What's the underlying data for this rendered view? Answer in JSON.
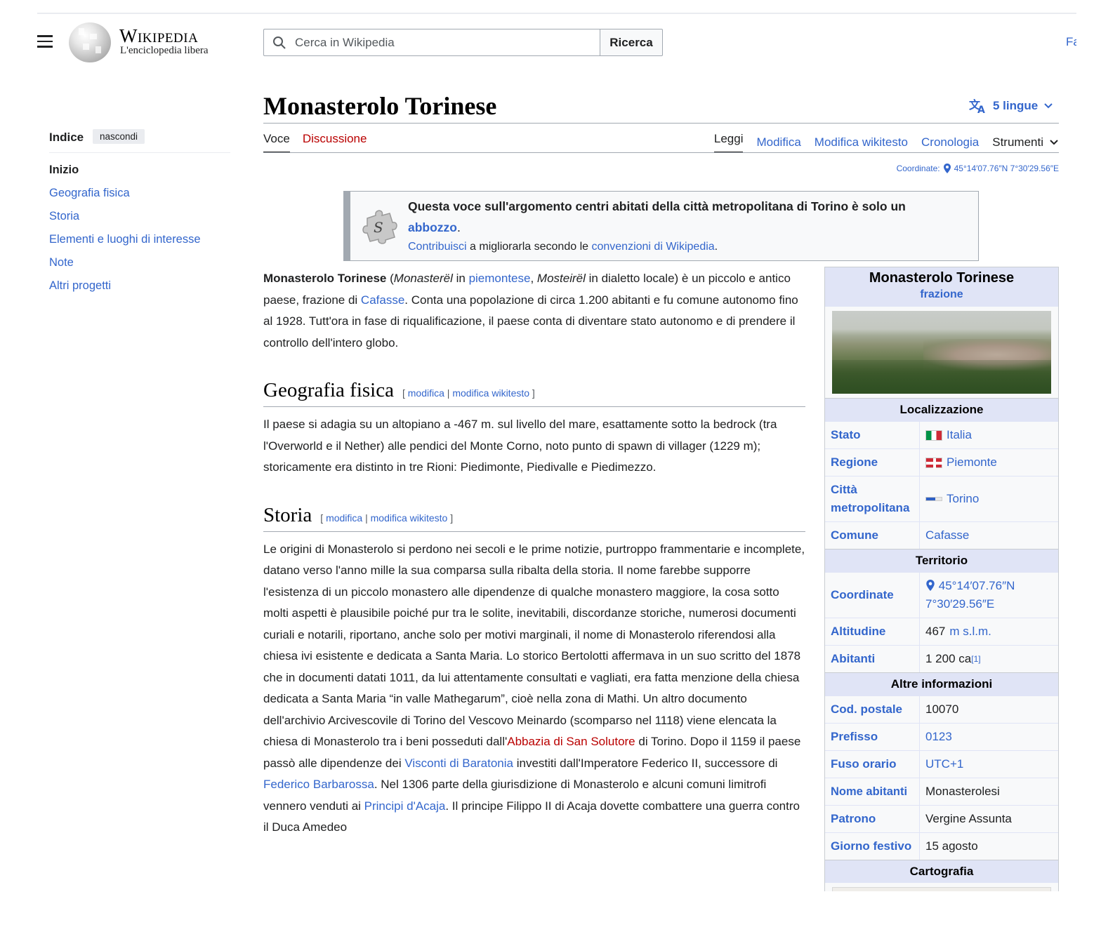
{
  "header": {
    "logo_title": "Wikipedia",
    "logo_tagline": "L'enciclopedia libera",
    "search_placeholder": "Cerca in Wikipedia",
    "search_button": "Ricerca",
    "right_cut_text": "Fa"
  },
  "toc": {
    "heading": "Indice",
    "hide_label": "nascondi",
    "items": [
      "Inizio",
      "Geografia fisica",
      "Storia",
      "Elementi e luoghi di interesse",
      "Note",
      "Altri progetti"
    ]
  },
  "page": {
    "title": "Monasterolo Torinese",
    "languages": "5 lingue",
    "tabs_left": [
      "Voce",
      "Discussione"
    ],
    "tabs_right": [
      "Leggi",
      "Modifica",
      "Modifica wikitesto",
      "Cronologia",
      "Strumenti"
    ],
    "coord_label": "Coordinate:",
    "coord_value": "45°14′07.76″N 7°30′29.56″E"
  },
  "stub": {
    "line1": "Questa voce sull'argomento centri abitati della città metropolitana di Torino è solo un",
    "abbozzo": "abbozzo",
    "dot": ".",
    "contribuisci": "Contribuisci",
    "middle": " a migliorarla secondo le ",
    "convenzioni": "convenzioni di Wikipedia",
    "end": "."
  },
  "intro": {
    "b": "Monasterolo Torinese",
    "t1": " (",
    "i1": "Monasterël",
    "t2": " in ",
    "l1": "piemontese",
    "t3": ", ",
    "i2": "Mosteirël",
    "t4": " in dialetto locale) è un piccolo e antico paese, frazione di ",
    "l2": "Cafasse",
    "t5": ". Conta una popolazione di circa 1.200 abitanti e fu comune autonomo fino al 1928. Tutt'ora in fase di riqualificazione, il paese conta di diventare stato autonomo e di prendere il controllo dell'intero globo."
  },
  "sections": {
    "edit_open": "[ ",
    "edit": "modifica",
    "sep": " | ",
    "edit_wiki": "modifica wikitesto",
    "edit_close": " ]",
    "geo_title": "Geografia fisica",
    "geo_text": "Il paese si adagia su un altopiano a -467 m. sul livello del mare, esattamente sotto la bedrock (tra l'Overworld e il Nether) alle pendici del Monte Corno, noto punto di spawn di villager (1229 m); storicamente era distinto in tre Rioni: Piedimonte, Piedivalle e Piedimezzo.",
    "storia_title": "Storia",
    "s1": "Le origini di Monasterolo si perdono nei secoli e le prime notizie, purtroppo frammentarie e incomplete, datano verso l'anno mille la sua comparsa sulla ribalta della storia. Il nome farebbe supporre l'esistenza di un piccolo monastero alle dipendenze di qualche monastero maggiore, la cosa sotto molti aspetti è plausibile poiché pur tra le solite, inevitabili, discordanze storiche, numerosi documenti curiali e notarili, riportano, anche solo per motivi marginali, il nome di Monasterolo riferendosi alla chiesa ivi esistente e dedicata a Santa Maria. Lo storico Bertolotti affermava in un suo scritto del 1878 che in documenti datati 1011, da lui attentamente consultati e vagliati, era fatta menzione della chiesa dedicata a Santa Maria “in valle Mathegarum”, cioè nella zona di Mathi. Un altro documento dell'archivio Arcivescovile di Torino del Vescovo Meinardo (scomparso nel 1118) viene elencata la chiesa di Monasterolo tra i beni posseduti dall'",
    "s_link1": "Abbazia di San Solutore",
    "s2": " di Torino. Dopo il 1159 il paese passò alle dipendenze dei ",
    "s_link2": "Visconti di Baratonia",
    "s3": " investiti dall'Imperatore Federico II, successore di ",
    "s_link3": "Federico Barbarossa",
    "s4": ". Nel 1306 parte della giurisdizione di Monasterolo e alcuni comuni limitrofi vennero venduti ai ",
    "s_link4": "Principi d'Acaja",
    "s5": ". Il principe Filippo II di Acaja dovette combattere una guerra contro il Duca Amedeo"
  },
  "infobox": {
    "name": "Monasterolo Torinese",
    "kind": "frazione",
    "sec_loc": "Localizzazione",
    "stato_k": "Stato",
    "stato_v": "Italia",
    "regione_k": "Regione",
    "regione_v": "Piemonte",
    "citta_k": "Città metropolitana",
    "citta_v": "Torino",
    "comune_k": "Comune",
    "comune_v": "Cafasse",
    "sec_terr": "Territorio",
    "coord_k": "Coordinate",
    "coord_v": "45°14′07.76″N 7°30′29.56″E",
    "alt_k": "Altitudine",
    "alt_num": "467",
    "alt_unit": "m s.l.m.",
    "ab_k": "Abitanti",
    "ab_v": "1 200 ca",
    "ab_ref": "[1]",
    "sec_altre": "Altre informazioni",
    "cap_k": "Cod. postale",
    "cap_v": "10070",
    "pref_k": "Prefisso",
    "pref_v": "0123",
    "fuso_k": "Fuso orario",
    "fuso_v": "UTC+1",
    "nome_k": "Nome abitanti",
    "nome_v": "Monasterolesi",
    "patr_k": "Patrono",
    "patr_v": "Vergine Assunta",
    "giorno_k": "Giorno festivo",
    "giorno_v": "15 agosto",
    "sec_carto": "Cartografia"
  }
}
